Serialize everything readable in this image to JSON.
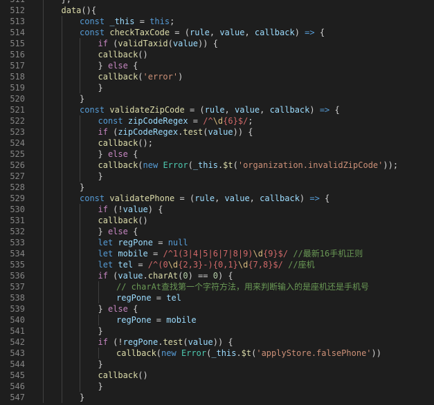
{
  "editor": {
    "theme": {
      "background": "#1e1e1e",
      "line_number": "#858585",
      "indent_guide": "#404040",
      "keyword": "#569cd6",
      "control": "#c586c0",
      "function": "#dcdcaa",
      "variable": "#9cdcfe",
      "string": "#ce9178",
      "number": "#b5cea8",
      "regex": "#d16969",
      "class": "#4ec9b0",
      "comment": "#6a9955"
    },
    "lines": [
      {
        "n": "511",
        "i": 1,
        "t": [
          [
            "},",
            "p"
          ]
        ]
      },
      {
        "n": "512",
        "i": 1,
        "t": [
          [
            "data",
            "fn"
          ],
          [
            "(){",
            "p"
          ]
        ]
      },
      {
        "n": "513",
        "i": 2,
        "t": [
          [
            "const",
            "kw"
          ],
          [
            " ",
            "p"
          ],
          [
            "_this",
            "var"
          ],
          [
            " = ",
            "p"
          ],
          [
            "this",
            "kw"
          ],
          [
            ";",
            "p"
          ]
        ]
      },
      {
        "n": "514",
        "i": 2,
        "t": [
          [
            "const",
            "kw"
          ],
          [
            " ",
            "p"
          ],
          [
            "checkTaxCode",
            "fn"
          ],
          [
            " = (",
            "p"
          ],
          [
            "rule",
            "var"
          ],
          [
            ", ",
            "p"
          ],
          [
            "value",
            "var"
          ],
          [
            ", ",
            "p"
          ],
          [
            "callback",
            "var"
          ],
          [
            ") ",
            "p"
          ],
          [
            "=>",
            "kw"
          ],
          [
            " {",
            "p"
          ]
        ]
      },
      {
        "n": "515",
        "i": 3,
        "t": [
          [
            "if",
            "ctl"
          ],
          [
            " (",
            "p"
          ],
          [
            "validTaxid",
            "fn"
          ],
          [
            "(",
            "p"
          ],
          [
            "value",
            "var"
          ],
          [
            ")) {",
            "p"
          ]
        ]
      },
      {
        "n": "516",
        "i": 3,
        "t": [
          [
            "callback",
            "fn"
          ],
          [
            "()",
            "p"
          ]
        ]
      },
      {
        "n": "517",
        "i": 3,
        "t": [
          [
            "} ",
            "p"
          ],
          [
            "else",
            "ctl"
          ],
          [
            " {",
            "p"
          ]
        ]
      },
      {
        "n": "518",
        "i": 3,
        "t": [
          [
            "callback",
            "fn"
          ],
          [
            "(",
            "p"
          ],
          [
            "'error'",
            "str"
          ],
          [
            ")",
            "p"
          ]
        ]
      },
      {
        "n": "519",
        "i": 3,
        "t": [
          [
            "}",
            "p"
          ]
        ]
      },
      {
        "n": "520",
        "i": 2,
        "t": [
          [
            "}",
            "p"
          ]
        ]
      },
      {
        "n": "521",
        "i": 2,
        "t": [
          [
            "const",
            "kw"
          ],
          [
            " ",
            "p"
          ],
          [
            "validateZipCode",
            "fn"
          ],
          [
            " = (",
            "p"
          ],
          [
            "rule",
            "var"
          ],
          [
            ", ",
            "p"
          ],
          [
            "value",
            "var"
          ],
          [
            ", ",
            "p"
          ],
          [
            "callback",
            "var"
          ],
          [
            ") ",
            "p"
          ],
          [
            "=>",
            "kw"
          ],
          [
            " {",
            "p"
          ]
        ]
      },
      {
        "n": "522",
        "i": 3,
        "t": [
          [
            "const",
            "kw"
          ],
          [
            " ",
            "p"
          ],
          [
            "zipCodeRegex",
            "var"
          ],
          [
            " = ",
            "p"
          ],
          [
            "/^",
            "rx"
          ],
          [
            "\\d",
            "esc"
          ],
          [
            "{6}",
            "rx"
          ],
          [
            "$/",
            "rx"
          ],
          [
            ";",
            "p"
          ]
        ]
      },
      {
        "n": "523",
        "i": 3,
        "t": [
          [
            "if",
            "ctl"
          ],
          [
            " (",
            "p"
          ],
          [
            "zipCodeRegex",
            "var"
          ],
          [
            ".",
            "p"
          ],
          [
            "test",
            "fn"
          ],
          [
            "(",
            "p"
          ],
          [
            "value",
            "var"
          ],
          [
            ")) {",
            "p"
          ]
        ]
      },
      {
        "n": "524",
        "i": 3,
        "t": [
          [
            "callback",
            "fn"
          ],
          [
            "();",
            "p"
          ]
        ]
      },
      {
        "n": "525",
        "i": 3,
        "t": [
          [
            "} ",
            "p"
          ],
          [
            "else",
            "ctl"
          ],
          [
            " {",
            "p"
          ]
        ]
      },
      {
        "n": "526",
        "i": 3,
        "t": [
          [
            "callback",
            "fn"
          ],
          [
            "(",
            "p"
          ],
          [
            "new",
            "kw"
          ],
          [
            " ",
            "p"
          ],
          [
            "Error",
            "cls"
          ],
          [
            "(",
            "p"
          ],
          [
            "_this",
            "var"
          ],
          [
            ".",
            "p"
          ],
          [
            "$t",
            "fn"
          ],
          [
            "(",
            "p"
          ],
          [
            "'organization.invalidZipCode'",
            "str"
          ],
          [
            "));",
            "p"
          ]
        ]
      },
      {
        "n": "527",
        "i": 3,
        "t": [
          [
            "}",
            "p"
          ]
        ]
      },
      {
        "n": "528",
        "i": 2,
        "t": [
          [
            "}",
            "p"
          ]
        ]
      },
      {
        "n": "529",
        "i": 2,
        "t": [
          [
            "const",
            "kw"
          ],
          [
            " ",
            "p"
          ],
          [
            "validatePhone",
            "fn"
          ],
          [
            " = (",
            "p"
          ],
          [
            "rule",
            "var"
          ],
          [
            ", ",
            "p"
          ],
          [
            "value",
            "var"
          ],
          [
            ", ",
            "p"
          ],
          [
            "callback",
            "var"
          ],
          [
            ") ",
            "p"
          ],
          [
            "=>",
            "kw"
          ],
          [
            " {",
            "p"
          ]
        ]
      },
      {
        "n": "530",
        "i": 3,
        "t": [
          [
            "if",
            "ctl"
          ],
          [
            " (!",
            "p"
          ],
          [
            "value",
            "var"
          ],
          [
            ") {",
            "p"
          ]
        ]
      },
      {
        "n": "531",
        "i": 3,
        "t": [
          [
            "callback",
            "fn"
          ],
          [
            "()",
            "p"
          ]
        ]
      },
      {
        "n": "532",
        "i": 3,
        "t": [
          [
            "} ",
            "p"
          ],
          [
            "else",
            "ctl"
          ],
          [
            " {",
            "p"
          ]
        ]
      },
      {
        "n": "533",
        "i": 3,
        "t": [
          [
            "let",
            "kw"
          ],
          [
            " ",
            "p"
          ],
          [
            "regPone",
            "var"
          ],
          [
            " = ",
            "p"
          ],
          [
            "null",
            "kw"
          ]
        ]
      },
      {
        "n": "534",
        "i": 3,
        "t": [
          [
            "let",
            "kw"
          ],
          [
            " ",
            "p"
          ],
          [
            "mobile",
            "var"
          ],
          [
            " = ",
            "p"
          ],
          [
            "/^1(3|4|5|6|7|8|9)",
            "rx"
          ],
          [
            "\\d",
            "esc"
          ],
          [
            "{9}$/",
            "rx"
          ],
          [
            " ",
            "p"
          ],
          [
            "//最新16手机正则",
            "cmt"
          ]
        ]
      },
      {
        "n": "535",
        "i": 3,
        "t": [
          [
            "let",
            "kw"
          ],
          [
            " ",
            "p"
          ],
          [
            "tel",
            "var"
          ],
          [
            " = ",
            "p"
          ],
          [
            "/^(0",
            "rx"
          ],
          [
            "\\d",
            "esc"
          ],
          [
            "{2,3}-){0,1}",
            "rx"
          ],
          [
            "\\d",
            "esc"
          ],
          [
            "{7,8}$/",
            "rx"
          ],
          [
            " ",
            "p"
          ],
          [
            "//座机",
            "cmt"
          ]
        ]
      },
      {
        "n": "536",
        "i": 3,
        "t": [
          [
            "if",
            "ctl"
          ],
          [
            " (",
            "p"
          ],
          [
            "value",
            "var"
          ],
          [
            ".",
            "p"
          ],
          [
            "charAt",
            "fn"
          ],
          [
            "(",
            "p"
          ],
          [
            "0",
            "num"
          ],
          [
            ") == ",
            "p"
          ],
          [
            "0",
            "num"
          ],
          [
            ") {",
            "p"
          ]
        ]
      },
      {
        "n": "537",
        "i": 4,
        "t": [
          [
            "// charAt查找第一个字符方法，用来判断输入的是座机还是手机号",
            "cmt"
          ]
        ]
      },
      {
        "n": "538",
        "i": 4,
        "t": [
          [
            "regPone",
            "var"
          ],
          [
            " = ",
            "p"
          ],
          [
            "tel",
            "var"
          ]
        ]
      },
      {
        "n": "539",
        "i": 3,
        "t": [
          [
            "} ",
            "p"
          ],
          [
            "else",
            "ctl"
          ],
          [
            " {",
            "p"
          ]
        ]
      },
      {
        "n": "540",
        "i": 4,
        "t": [
          [
            "regPone",
            "var"
          ],
          [
            " = ",
            "p"
          ],
          [
            "mobile",
            "var"
          ]
        ]
      },
      {
        "n": "541",
        "i": 3,
        "t": [
          [
            "}",
            "p"
          ]
        ]
      },
      {
        "n": "542",
        "i": 3,
        "t": [
          [
            "if",
            "ctl"
          ],
          [
            " (!",
            "p"
          ],
          [
            "regPone",
            "var"
          ],
          [
            ".",
            "p"
          ],
          [
            "test",
            "fn"
          ],
          [
            "(",
            "p"
          ],
          [
            "value",
            "var"
          ],
          [
            ")) {",
            "p"
          ]
        ]
      },
      {
        "n": "543",
        "i": 4,
        "t": [
          [
            "callback",
            "fn"
          ],
          [
            "(",
            "p"
          ],
          [
            "new",
            "kw"
          ],
          [
            " ",
            "p"
          ],
          [
            "Error",
            "cls"
          ],
          [
            "(",
            "p"
          ],
          [
            "_this",
            "var"
          ],
          [
            ".",
            "p"
          ],
          [
            "$t",
            "fn"
          ],
          [
            "(",
            "p"
          ],
          [
            "'applyStore.falsePhone'",
            "str"
          ],
          [
            "))",
            "p"
          ]
        ]
      },
      {
        "n": "544",
        "i": 3,
        "t": [
          [
            "}",
            "p"
          ]
        ]
      },
      {
        "n": "545",
        "i": 3,
        "t": [
          [
            "callback",
            "fn"
          ],
          [
            "()",
            "p"
          ]
        ]
      },
      {
        "n": "546",
        "i": 3,
        "t": [
          [
            "}",
            "p"
          ]
        ]
      },
      {
        "n": "547",
        "i": 2,
        "t": [
          [
            "}",
            "p"
          ]
        ]
      }
    ]
  }
}
